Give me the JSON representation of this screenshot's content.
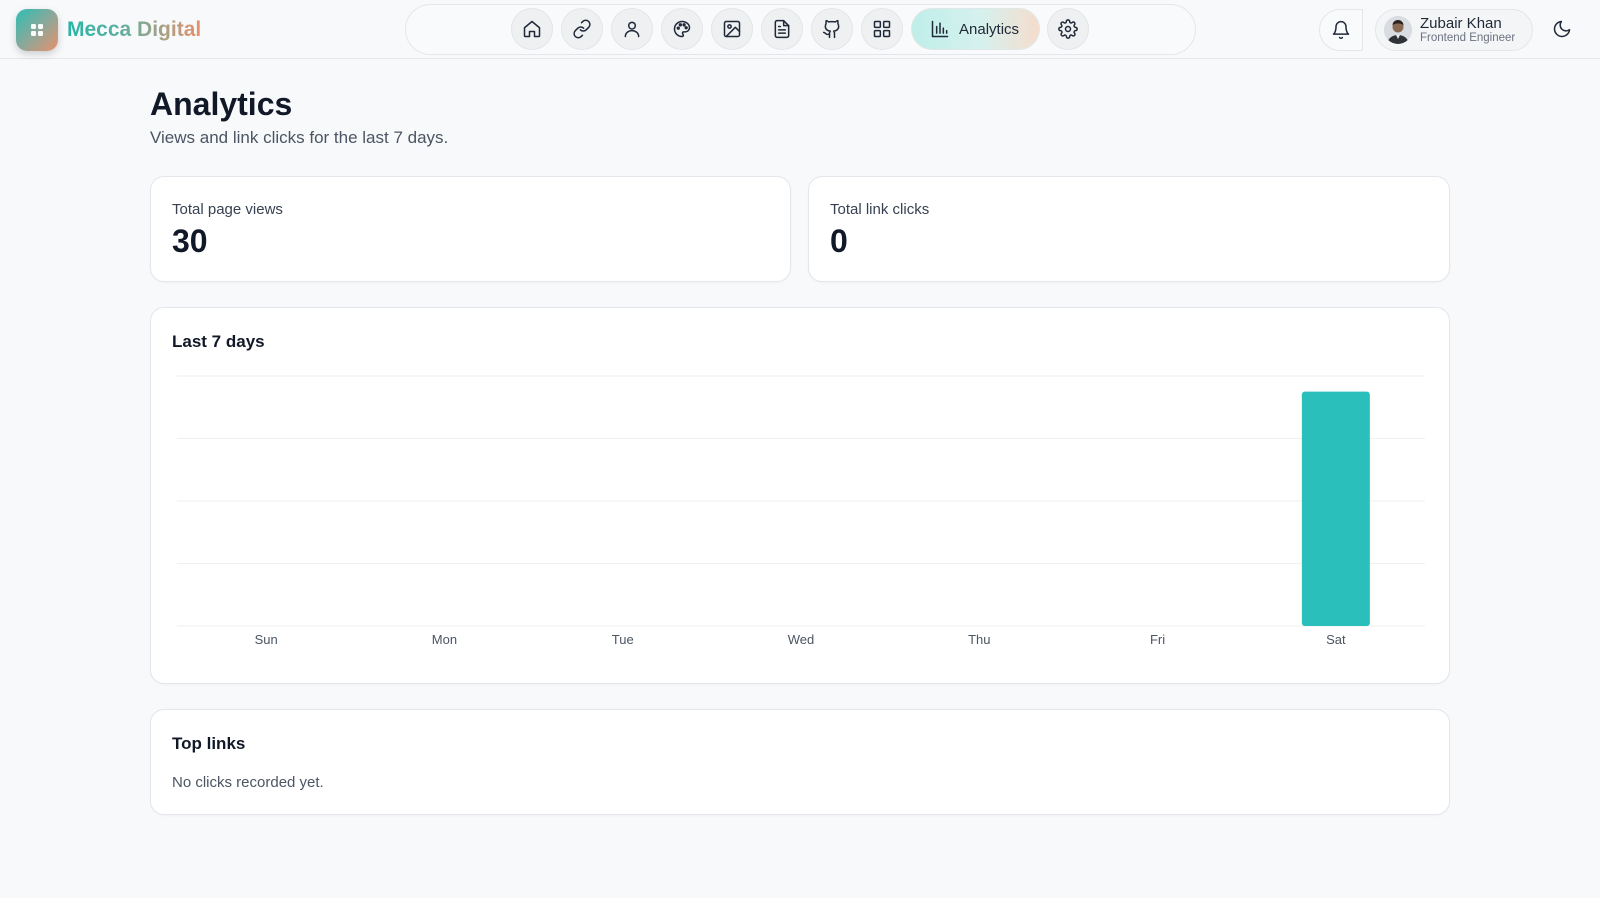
{
  "brand": {
    "name": "Mecca Digital"
  },
  "nav": {
    "items": [
      {
        "icon": "home-icon"
      },
      {
        "icon": "link-icon"
      },
      {
        "icon": "user-icon"
      },
      {
        "icon": "palette-icon"
      },
      {
        "icon": "image-icon"
      },
      {
        "icon": "document-icon"
      },
      {
        "icon": "github-icon"
      },
      {
        "icon": "grid-icon"
      },
      {
        "icon": "bar-chart-icon",
        "label": "Analytics",
        "active": true
      },
      {
        "icon": "gear-icon"
      }
    ]
  },
  "user": {
    "name": "Zubair Khan",
    "role": "Frontend Engineer"
  },
  "page": {
    "title": "Analytics",
    "subtitle": "Views and link clicks for the last 7 days."
  },
  "stats": {
    "views": {
      "label": "Total page views",
      "value": "30"
    },
    "clicks": {
      "label": "Total link clicks",
      "value": "0"
    }
  },
  "chart_card": {
    "title": "Last 7 days"
  },
  "chart_data": {
    "type": "bar",
    "categories": [
      "Sun",
      "Mon",
      "Tue",
      "Wed",
      "Thu",
      "Fri",
      "Sat"
    ],
    "values": [
      0,
      0,
      0,
      0,
      0,
      0,
      30
    ],
    "ylim": [
      0,
      32
    ],
    "grid": true,
    "color": "#2bbfbb"
  },
  "top_links": {
    "title": "Top links",
    "empty_text": "No clicks recorded yet."
  },
  "colors": {
    "accent": "#2bbfbb",
    "brand_teal": "#26b5a8",
    "brand_orange": "#e8916b"
  }
}
